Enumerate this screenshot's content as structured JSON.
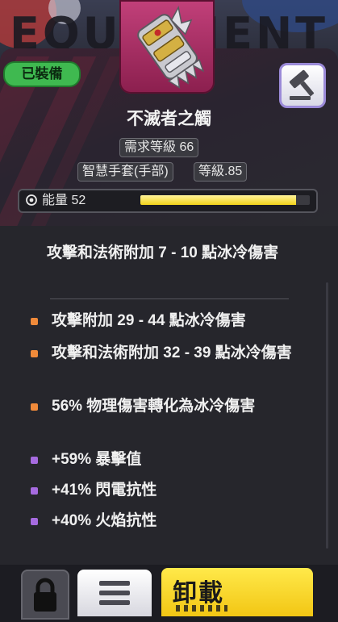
{
  "background": {
    "banner_text": "EQUIPMENT"
  },
  "status": {
    "equipped_label": "已裝備"
  },
  "item": {
    "name": "不滅者之觸",
    "required_level": "需求等級 66",
    "type": "智慧手套(手部)",
    "item_level": "等級.85",
    "energy_label": "能量 52",
    "energy_fill_fraction": 0.92,
    "icon": "gauntlet-icon"
  },
  "implicit_mod": "攻擊和法術附加 7 - 10 點冰冷傷害",
  "mods": [
    {
      "text": "攻擊附加 29 - 44 點冰冷傷害",
      "color": "#f08a3a"
    },
    {
      "text": "攻擊和法術附加 32 - 39 點冰冷傷害",
      "color": "#f08a3a"
    },
    {
      "text": "56% 物理傷害轉化為冰冷傷害",
      "color": "#f08a3a"
    },
    {
      "text": "+59% 暴擊值",
      "color": "#a66be0"
    },
    {
      "text": "+41% 閃電抗性",
      "color": "#a66be0"
    },
    {
      "text": "+40% 火焰抗性",
      "color": "#a66be0"
    }
  ],
  "actions": {
    "sell_icon": "gavel-icon",
    "lock_icon": "lock-icon",
    "menu_icon": "menu-icon",
    "unequip_label": "卸載"
  },
  "colors": {
    "equipped_green": "#3fb950",
    "rarity_frame": "#c2407a",
    "energy_yellow": "#f2d21a",
    "unequip_yellow": "#f2c614"
  }
}
